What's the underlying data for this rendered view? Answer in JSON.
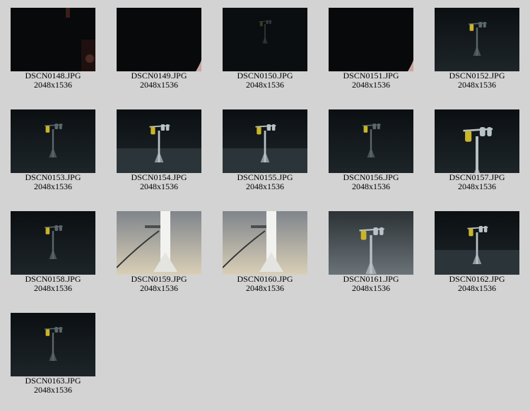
{
  "gallery": {
    "items": [
      {
        "filename": "DSCN0148.JPG",
        "dimensions": "2048x1536",
        "scene": "dark-edge"
      },
      {
        "filename": "DSCN0149.JPG",
        "dimensions": "2048x1536",
        "scene": "dark"
      },
      {
        "filename": "DSCN0150.JPG",
        "dimensions": "2048x1536",
        "scene": "faint-rig"
      },
      {
        "filename": "DSCN0151.JPG",
        "dimensions": "2048x1536",
        "scene": "dark"
      },
      {
        "filename": "DSCN0152.JPG",
        "dimensions": "2048x1536",
        "scene": "rig-dim"
      },
      {
        "filename": "DSCN0153.JPG",
        "dimensions": "2048x1536",
        "scene": "rig-dim"
      },
      {
        "filename": "DSCN0154.JPG",
        "dimensions": "2048x1536",
        "scene": "rig-yellow"
      },
      {
        "filename": "DSCN0155.JPG",
        "dimensions": "2048x1536",
        "scene": "rig-yellow"
      },
      {
        "filename": "DSCN0156.JPG",
        "dimensions": "2048x1536",
        "scene": "rig-dim"
      },
      {
        "filename": "DSCN0157.JPG",
        "dimensions": "2048x1536",
        "scene": "rig-close"
      },
      {
        "filename": "DSCN0158.JPG",
        "dimensions": "2048x1536",
        "scene": "rig-dim"
      },
      {
        "filename": "DSCN0159.JPG",
        "dimensions": "2048x1536",
        "scene": "pole-bright"
      },
      {
        "filename": "DSCN0160.JPG",
        "dimensions": "2048x1536",
        "scene": "pole-bright"
      },
      {
        "filename": "DSCN0161.JPG",
        "dimensions": "2048x1536",
        "scene": "rig-bright"
      },
      {
        "filename": "DSCN0162.JPG",
        "dimensions": "2048x1536",
        "scene": "rig-yellow"
      },
      {
        "filename": "DSCN0163.JPG",
        "dimensions": "2048x1536",
        "scene": "rig-dim"
      }
    ]
  }
}
